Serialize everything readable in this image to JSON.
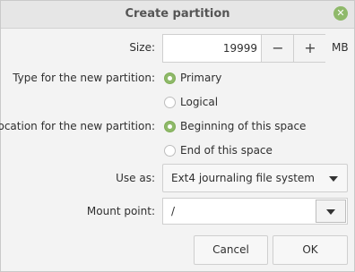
{
  "window": {
    "title": "Create partition"
  },
  "size": {
    "label": "Size:",
    "value": "19999",
    "minus": "−",
    "plus": "+",
    "unit": "MB"
  },
  "type": {
    "label": "Type for the new partition:",
    "options": [
      {
        "label": "Primary",
        "checked": true
      },
      {
        "label": "Logical",
        "checked": false
      }
    ]
  },
  "location": {
    "label": "Location for the new partition:",
    "options": [
      {
        "label": "Beginning of this space",
        "checked": true
      },
      {
        "label": "End of this space",
        "checked": false
      }
    ]
  },
  "use_as": {
    "label": "Use as:",
    "value": "Ext4 journaling file system"
  },
  "mount_point": {
    "label": "Mount point:",
    "value": "/"
  },
  "buttons": {
    "cancel": "Cancel",
    "ok": "OK"
  },
  "colors": {
    "accent": "#8fb96a"
  },
  "icons": {
    "close": "close-icon",
    "dropdown": "chevron-down-icon"
  }
}
